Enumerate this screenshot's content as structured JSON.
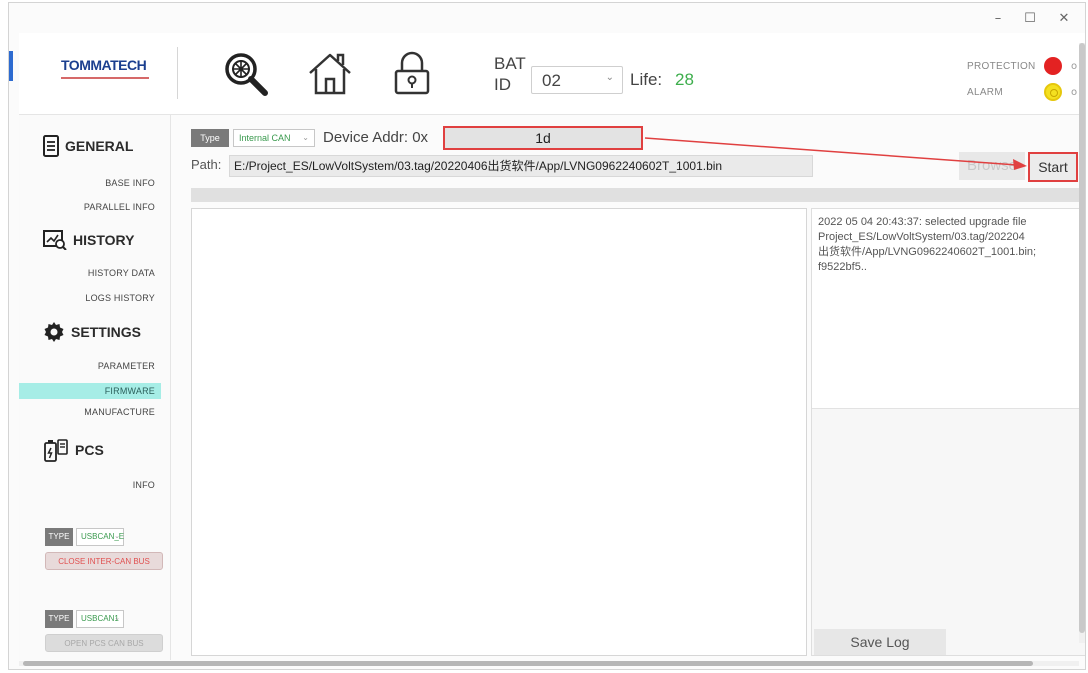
{
  "window": {
    "minimize": "–",
    "maximize": "☐",
    "close": "✕"
  },
  "header": {
    "logo_text": "TOMMATECH",
    "bat_label_1": "BAT",
    "bat_label_2": "ID",
    "bat_id": "02",
    "life_label": "Life:",
    "life_value": "28",
    "protection_label": "PROTECTION",
    "alarm_label": "ALARM",
    "protection_tail": "o",
    "alarm_tail": "o"
  },
  "sidebar": {
    "general": {
      "label": "GENERAL",
      "items": [
        "BASE INFO",
        "PARALLEL INFO"
      ]
    },
    "history": {
      "label": "HISTORY",
      "items": [
        "HISTORY DATA",
        "LOGS HISTORY"
      ]
    },
    "settings": {
      "label": "SETTINGS",
      "items": [
        "PARAMETER",
        "FIRMWARE",
        "MANUFACTURE"
      ]
    },
    "pcs": {
      "label": "PCS",
      "items": [
        "INFO"
      ]
    },
    "active_item": "FIRMWARE",
    "inter_can": {
      "type": "TYPE",
      "value": "USBCAN_E",
      "button": "CLOSE INTER-CAN BUS"
    },
    "pcs_can": {
      "type": "TYPE",
      "value": "USBCAN1",
      "button": "OPEN PCS CAN BUS"
    }
  },
  "upgrade": {
    "type_label": "Type",
    "can_type": "Internal CAN",
    "device_addr_label": "Device Addr: 0x",
    "device_addr": "1d",
    "path_label": "Path:",
    "path_value": "E:/Project_ES/LowVoltSystem/03.tag/20220406出货软件/App/LVNG0962240602T_1001.bin",
    "browse_label": "Browse",
    "start_label": "Start",
    "progress": 0,
    "log_text": "2022 05 04 20:43:37: selected upgrade file\nProject_ES/LowVoltSystem/03.tag/202204\n出货软件/App/LVNG0962240602T_1001.bin;\nf9522bf5..",
    "save_log_label": "Save Log"
  },
  "colors": {
    "protection_led": "#e32222",
    "alarm_led": "#f4e020",
    "life_value": "#3dae4c",
    "active_item": "#a6ede6",
    "highlight_border": "#e04040"
  }
}
